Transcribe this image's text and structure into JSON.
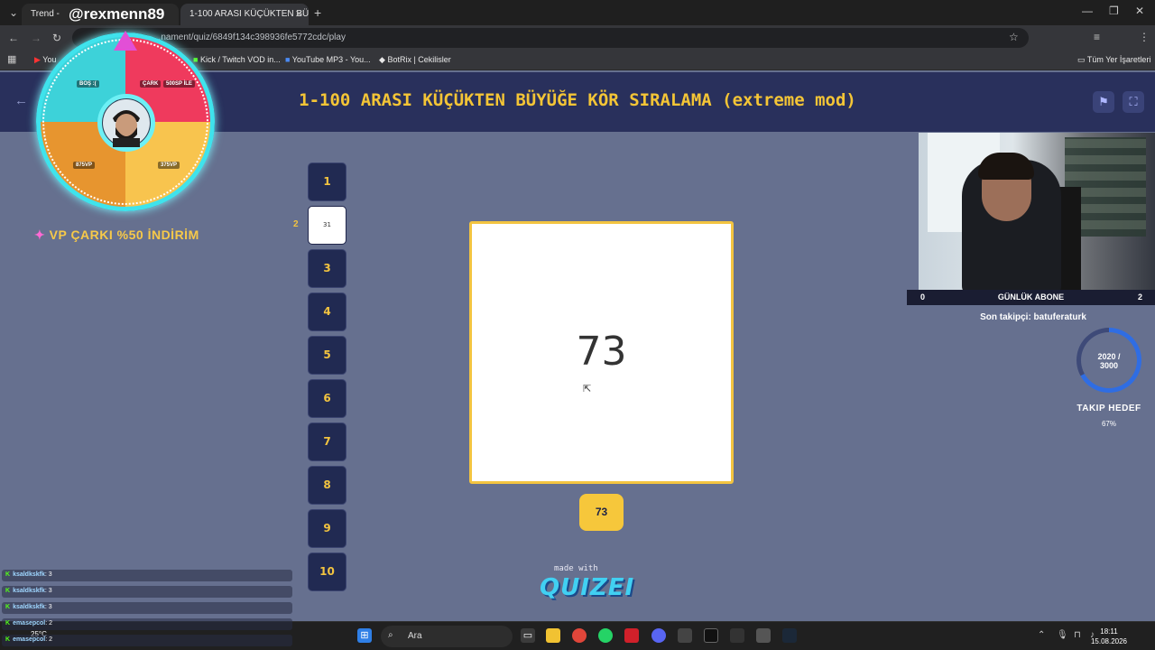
{
  "browser": {
    "tabs": [
      {
        "label": "Trend -"
      },
      {
        "label": "@rexmenn89"
      },
      {
        "label": "1-100 ARASI KÜÇÜKTEN BÜYÜ"
      }
    ],
    "url": "...nament/quiz/6849f134c398936fe5772cdc/play",
    "bookmarks": [
      "You",
      "Kick / Twitch VOD in...",
      "YouTube MP3 - You...",
      "BotRix | Cekilisler",
      "Tüm Yer İşaretleri"
    ]
  },
  "quiz": {
    "title": "1-100 ARASI KÜÇÜKTEN BÜYÜĞE KÖR SIRALAMA (extreme mod)",
    "slots": [
      {
        "label": "1"
      },
      {
        "label": "31"
      },
      {
        "label": "3"
      },
      {
        "label": "4"
      },
      {
        "label": "5"
      },
      {
        "label": "6"
      },
      {
        "label": "7"
      },
      {
        "label": "8"
      },
      {
        "label": "9"
      },
      {
        "label": "10"
      }
    ],
    "slot_side_label": "2",
    "current_number": "73",
    "answer_button": "73",
    "made_with": "made with",
    "brand": "QUIZEI"
  },
  "overlay": {
    "wheel_labels": [
      "BOŞ :(",
      "ÇARK",
      "500SP İLE",
      "875VP",
      "375VP"
    ],
    "promo": "VP ÇARKI %50 İNDİRİM",
    "sub_bar": {
      "left": "0",
      "title": "GÜNLÜK ABONE",
      "right": "2"
    },
    "last_follower": "Son takipçi: batuferaturk",
    "goal": {
      "progress": "2020 /",
      "target": "3000",
      "title": "TAKIP HEDEF",
      "percent": "67%",
      "fraction": 0.67
    },
    "chat": [
      {
        "user": "ksaldkskfk",
        "msg": ": 3"
      },
      {
        "user": "ksaldkskfk",
        "msg": ": 3"
      },
      {
        "user": "ksaldkskfk",
        "msg": ": 3"
      },
      {
        "user": "emasepcol",
        "msg": ": 2"
      },
      {
        "user": "emasepcol",
        "msg": ": 2"
      }
    ]
  },
  "taskbar": {
    "search_placeholder": "Ara",
    "weather": "25°C",
    "time": "18:11",
    "date": "15.08.2026"
  },
  "colors": {
    "accent": "#f3c440",
    "header_bg": "#29305c",
    "page_bg": "#66708f"
  }
}
